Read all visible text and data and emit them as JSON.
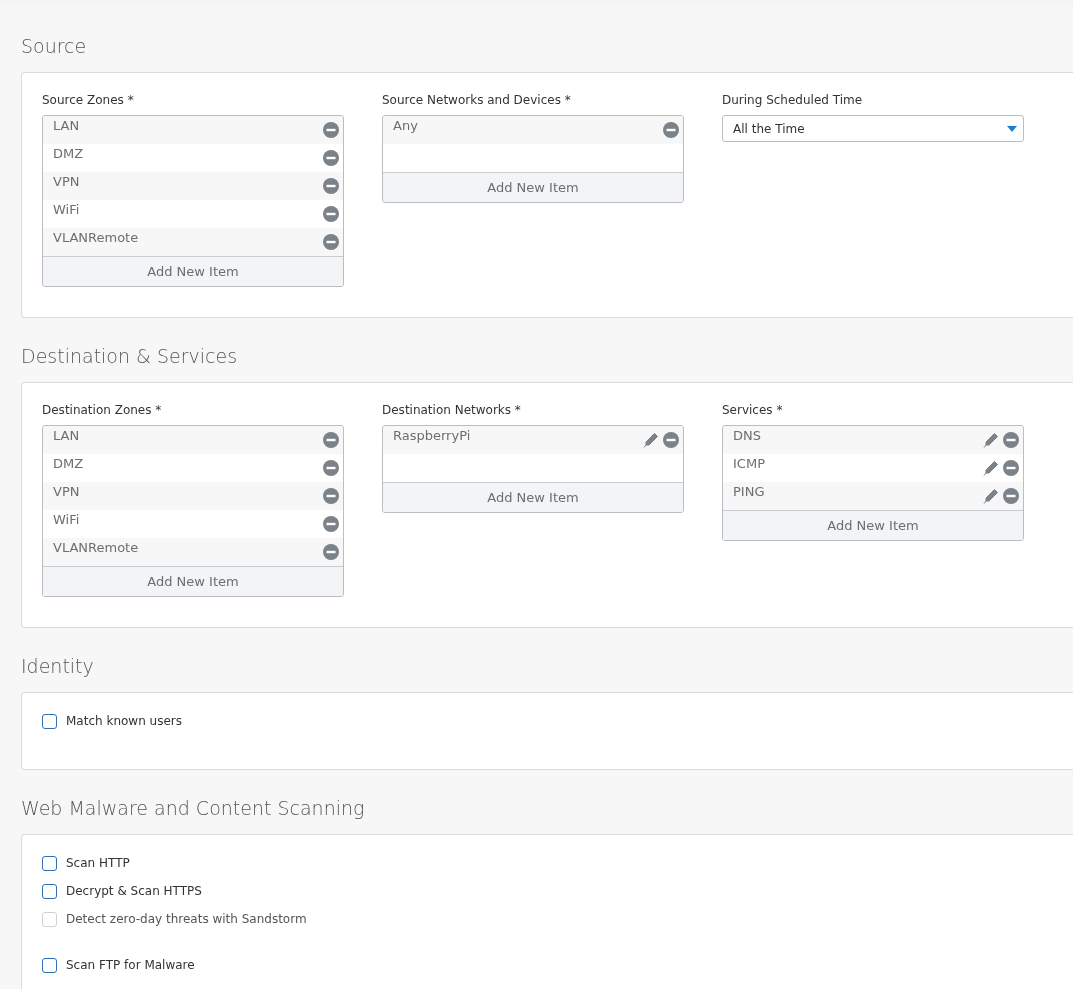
{
  "sections": [
    {
      "kind": "fields",
      "title": "Source",
      "fields": [
        {
          "kind": "list",
          "label": "Source Zones *",
          "items": [
            {
              "text": "LAN",
              "editable": false
            },
            {
              "text": "DMZ",
              "editable": false
            },
            {
              "text": "VPN",
              "editable": false
            },
            {
              "text": "WiFi",
              "editable": false
            },
            {
              "text": "VLANRemote",
              "editable": false
            }
          ],
          "add_label": "Add New Item"
        },
        {
          "kind": "list",
          "label": "Source Networks and Devices *",
          "items": [
            {
              "text": "Any",
              "editable": false
            }
          ],
          "add_label": "Add New Item"
        },
        {
          "kind": "select",
          "label": "During Scheduled Time",
          "value": "All the Time"
        }
      ]
    },
    {
      "kind": "fields",
      "title": "Destination & Services",
      "fields": [
        {
          "kind": "list",
          "label": "Destination Zones *",
          "items": [
            {
              "text": "LAN",
              "editable": false
            },
            {
              "text": "DMZ",
              "editable": false
            },
            {
              "text": "VPN",
              "editable": false
            },
            {
              "text": "WiFi",
              "editable": false
            },
            {
              "text": "VLANRemote",
              "editable": false
            }
          ],
          "add_label": "Add New Item"
        },
        {
          "kind": "list",
          "label": "Destination Networks *",
          "items": [
            {
              "text": "RaspberryPi",
              "editable": true
            }
          ],
          "add_label": "Add New Item"
        },
        {
          "kind": "list",
          "label": "Services *",
          "items": [
            {
              "text": "DNS",
              "editable": true
            },
            {
              "text": "ICMP",
              "editable": true
            },
            {
              "text": "PING",
              "editable": true
            }
          ],
          "add_label": "Add New Item"
        }
      ]
    },
    {
      "kind": "checks",
      "title": "Identity",
      "groups": [
        [
          {
            "label": "Match known users",
            "checked": false,
            "disabled": false
          }
        ]
      ]
    },
    {
      "kind": "checks",
      "title": "Web Malware and Content Scanning",
      "groups": [
        [
          {
            "label": "Scan HTTP",
            "checked": false,
            "disabled": false
          },
          {
            "label": "Decrypt & Scan HTTPS",
            "checked": false,
            "disabled": false
          },
          {
            "label": "Detect zero-day threats with Sandstorm",
            "checked": false,
            "disabled": true
          }
        ],
        [
          {
            "label": "Scan FTP for Malware",
            "checked": false,
            "disabled": false
          }
        ]
      ]
    }
  ]
}
